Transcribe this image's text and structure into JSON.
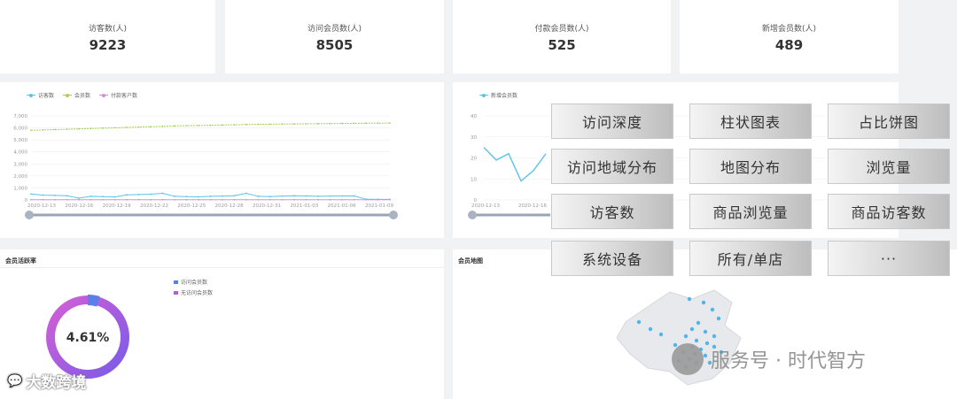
{
  "stats": [
    {
      "label": "访客数(人)",
      "value": "9223"
    },
    {
      "label": "访问会员数(人)",
      "value": "8505"
    },
    {
      "label": "付款会员数(人)",
      "value": "525"
    },
    {
      "label": "新增会员数(人)",
      "value": "489"
    }
  ],
  "colors": {
    "visitors": "#5bc2ec",
    "members": "#a8d05a",
    "paying": "#d58ed8",
    "ring_start": "#d35fd6",
    "ring_end": "#7a5be8"
  },
  "left_chart": {
    "legend": [
      "访客数",
      "会员数",
      "付款客户数"
    ],
    "y_ticks": [
      "7,000",
      "6,000",
      "5,000",
      "4,000",
      "3,000",
      "2,000",
      "1,000",
      "0"
    ],
    "x_ticks": [
      "2020-12-13",
      "2020-12-16",
      "2020-12-19",
      "2020-12-22",
      "2020-12-25",
      "2020-12-28",
      "2020-12-31",
      "2021-01-03",
      "2021-01-06",
      "2021-01-09"
    ]
  },
  "right_chart": {
    "legend": [
      "新增会员数"
    ],
    "y_ticks": [
      "40",
      "30",
      "20",
      "10",
      "0"
    ],
    "x_ticks": [
      "2020-12-13",
      "2020-12-16",
      "2"
    ]
  },
  "chart_data": [
    {
      "type": "line",
      "xlim": [
        0,
        30
      ],
      "ylim": [
        0,
        7000
      ],
      "grid": true,
      "legend_position": "top-left",
      "x": [
        "2020-12-13",
        "2020-12-16",
        "2020-12-19",
        "2020-12-22",
        "2020-12-25",
        "2020-12-28",
        "2020-12-31",
        "2021-01-03",
        "2021-01-06",
        "2021-01-09"
      ],
      "series": [
        {
          "name": "访客数",
          "values": [
            500,
            400,
            380,
            350,
            150,
            300,
            280,
            250,
            420,
            450,
            480,
            550,
            300,
            280,
            260,
            300,
            320,
            350,
            550,
            300,
            280,
            320,
            350,
            330,
            300,
            320,
            330,
            340,
            60,
            50,
            50
          ]
        },
        {
          "name": "会员数",
          "values": [
            5800,
            5830,
            5860,
            5890,
            5920,
            5950,
            5980,
            6010,
            6040,
            6070,
            6100,
            6130,
            6160,
            6180,
            6200,
            6220,
            6240,
            6260,
            6280,
            6300,
            6310,
            6320,
            6330,
            6340,
            6350,
            6360,
            6370,
            6380,
            6390,
            6395,
            6400
          ]
        },
        {
          "name": "付款客户数",
          "values": [
            20,
            20,
            20,
            20,
            20,
            20,
            20,
            20,
            20,
            20,
            20,
            20,
            20,
            20,
            20,
            20,
            20,
            20,
            20,
            20,
            20,
            20,
            20,
            20,
            20,
            20,
            20,
            20,
            20,
            20,
            20
          ]
        }
      ]
    },
    {
      "type": "line",
      "ylim": [
        0,
        40
      ],
      "grid": true,
      "legend_position": "top-left",
      "series": [
        {
          "name": "新增会员数",
          "values": [
            25,
            19,
            22,
            9,
            14,
            22
          ]
        }
      ]
    },
    {
      "type": "pie",
      "title": "会员活跃率",
      "categories": [
        "访问会员数",
        "无访问会员数"
      ],
      "values": [
        4.61,
        95.39
      ],
      "center_label": "4.61%"
    }
  ],
  "activity": {
    "title": "会员活跃率",
    "legend": [
      "访问会员数",
      "无访问会员数"
    ],
    "center": "4.61%"
  },
  "map": {
    "title": "会员地图"
  },
  "buttons": [
    "访问深度",
    "柱状图表",
    "占比饼图",
    "访问地域分布",
    "地图分布",
    "浏览量",
    "访客数",
    "商品浏览量",
    "商品访客数",
    "系统设备",
    "所有/单店",
    "···"
  ],
  "watermarks": {
    "left": "大数跨境",
    "right": "服务号 · 时代智方"
  }
}
